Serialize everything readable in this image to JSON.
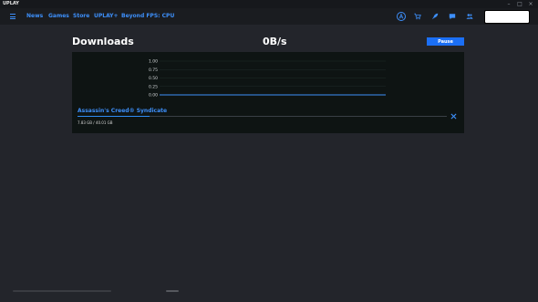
{
  "window": {
    "app_title": "UPLAY",
    "controls": {
      "minimize": "–",
      "maximize": "□",
      "close": "×"
    }
  },
  "nav": {
    "items": [
      {
        "label": "News"
      },
      {
        "label": "Games"
      },
      {
        "label": "Store"
      },
      {
        "label": "UPLAY+"
      },
      {
        "label": "Beyond FPS: CPU"
      }
    ],
    "icons": [
      "menu-icon",
      "account-icon",
      "cart-icon",
      "rocket-icon",
      "chat-icon",
      "friends-icon"
    ]
  },
  "search": {
    "value": ""
  },
  "downloads": {
    "title": "Downloads",
    "speed": "0B/s",
    "pause_label": "Pause"
  },
  "chart_data": {
    "type": "line",
    "y_ticks": [
      "1.00",
      "0.75",
      "0.50",
      "0.25",
      "0.00"
    ],
    "ylim": [
      0,
      1
    ],
    "series": [
      {
        "values": [
          0,
          0
        ]
      }
    ]
  },
  "item": {
    "game_title": "Assassin's Creed® Syndicate",
    "progress_text": "7.83 GB / 40.01 GB",
    "progress_fraction": 0.196
  },
  "colors": {
    "accent": "#3d8ffa",
    "button": "#1b6ff5",
    "background": "#23252b",
    "panel": "#0e1413"
  }
}
